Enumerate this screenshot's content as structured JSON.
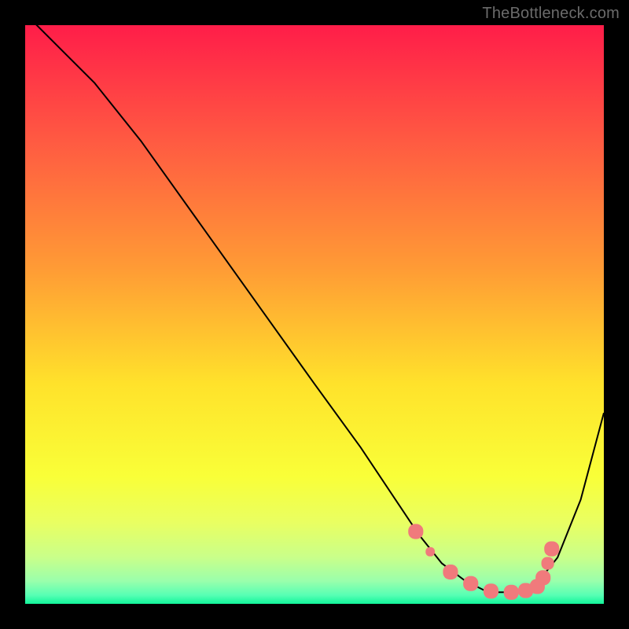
{
  "attribution": "TheBottleneck.com",
  "chart_data": {
    "type": "line",
    "title": "",
    "xlabel": "",
    "ylabel": "",
    "xlim": [
      0,
      100
    ],
    "ylim": [
      0,
      100
    ],
    "background_gradient_stops": [
      {
        "pct": 0.0,
        "color": "#ff1d49"
      },
      {
        "pct": 0.2,
        "color": "#ff5a42"
      },
      {
        "pct": 0.42,
        "color": "#ff9b35"
      },
      {
        "pct": 0.62,
        "color": "#ffe22b"
      },
      {
        "pct": 0.78,
        "color": "#f9ff38"
      },
      {
        "pct": 0.86,
        "color": "#e9ff62"
      },
      {
        "pct": 0.92,
        "color": "#c9ff8a"
      },
      {
        "pct": 0.96,
        "color": "#9bffab"
      },
      {
        "pct": 0.985,
        "color": "#57ffb4"
      },
      {
        "pct": 1.0,
        "color": "#12f59a"
      }
    ],
    "series": [
      {
        "name": "bottleneck-curve",
        "stroke": "#000000",
        "stroke_width": 2,
        "x": [
          0,
          7,
          12,
          20,
          30,
          40,
          50,
          58,
          64,
          68,
          72,
          76,
          80,
          84,
          88,
          92,
          96,
          100
        ],
        "values": [
          102,
          95,
          90,
          80,
          66,
          52,
          38,
          27,
          18,
          12,
          7,
          4,
          2,
          2,
          3,
          8,
          18,
          33
        ]
      }
    ],
    "markers": {
      "name": "optimal-zone-dots",
      "shape": "rounded-rect",
      "color": "#f07a7c",
      "x": [
        67.5,
        70.0,
        73.5,
        77.0,
        80.5,
        84.0,
        86.5,
        88.5,
        89.5,
        90.3,
        91.0
      ],
      "y": [
        12.5,
        9.0,
        5.5,
        3.5,
        2.2,
        2.0,
        2.3,
        3.0,
        4.5,
        7.0,
        9.5
      ],
      "size": [
        2.6,
        1.6,
        2.6,
        2.6,
        2.6,
        2.6,
        2.6,
        2.6,
        2.6,
        2.2,
        2.6
      ]
    }
  }
}
